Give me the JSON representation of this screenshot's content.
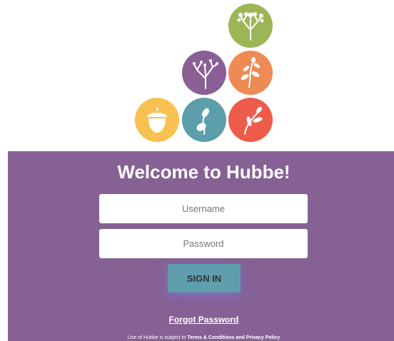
{
  "logo": {
    "icons": [
      {
        "name": "tree-icon",
        "color": "#9cb655"
      },
      {
        "name": "branch-icon",
        "color": "#8a5f95"
      },
      {
        "name": "leafy-branch-icon",
        "color": "#ee8a54"
      },
      {
        "name": "acorn-icon",
        "color": "#f8c150"
      },
      {
        "name": "sprout-icon",
        "color": "#5c9eaa"
      },
      {
        "name": "seedling-icon",
        "color": "#ef5b4b"
      }
    ]
  },
  "login": {
    "title": "Welcome to Hubbe!",
    "username_placeholder": "Username",
    "password_placeholder": "Password",
    "signin_label": "SIGN IN",
    "forgot_label": "Forgot Password",
    "terms_prefix": "Use of Hubbe is subject to ",
    "terms_link": "Terms & Conditions and Privacy Policy",
    "panel_color": "#856194",
    "button_color": "#5f9fad"
  }
}
